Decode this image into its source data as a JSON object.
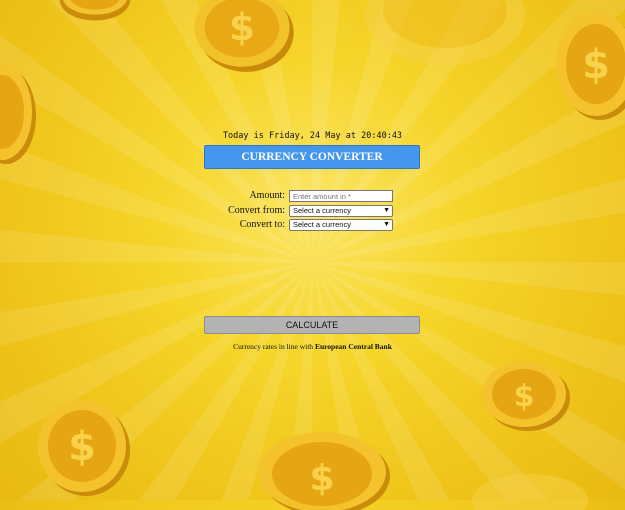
{
  "date_line": "Today is Friday, 24 May at 20:40:43",
  "title": "CURRENCY CONVERTER",
  "form": {
    "amount_label": "Amount:",
    "amount_placeholder": "Enter amount in *",
    "from_label": "Convert from:",
    "from_value": "Select a currency",
    "to_label": "Convert to:",
    "to_value": "Select a currency"
  },
  "calculate_label": "CALCULATE",
  "footer": {
    "text": "Currency rates in line with",
    "source": "European Central Bank"
  },
  "colors": {
    "background": "#f2c921",
    "title_bar": "#4597ee",
    "button": "#b3b3b3",
    "coin": "#e6a512"
  }
}
